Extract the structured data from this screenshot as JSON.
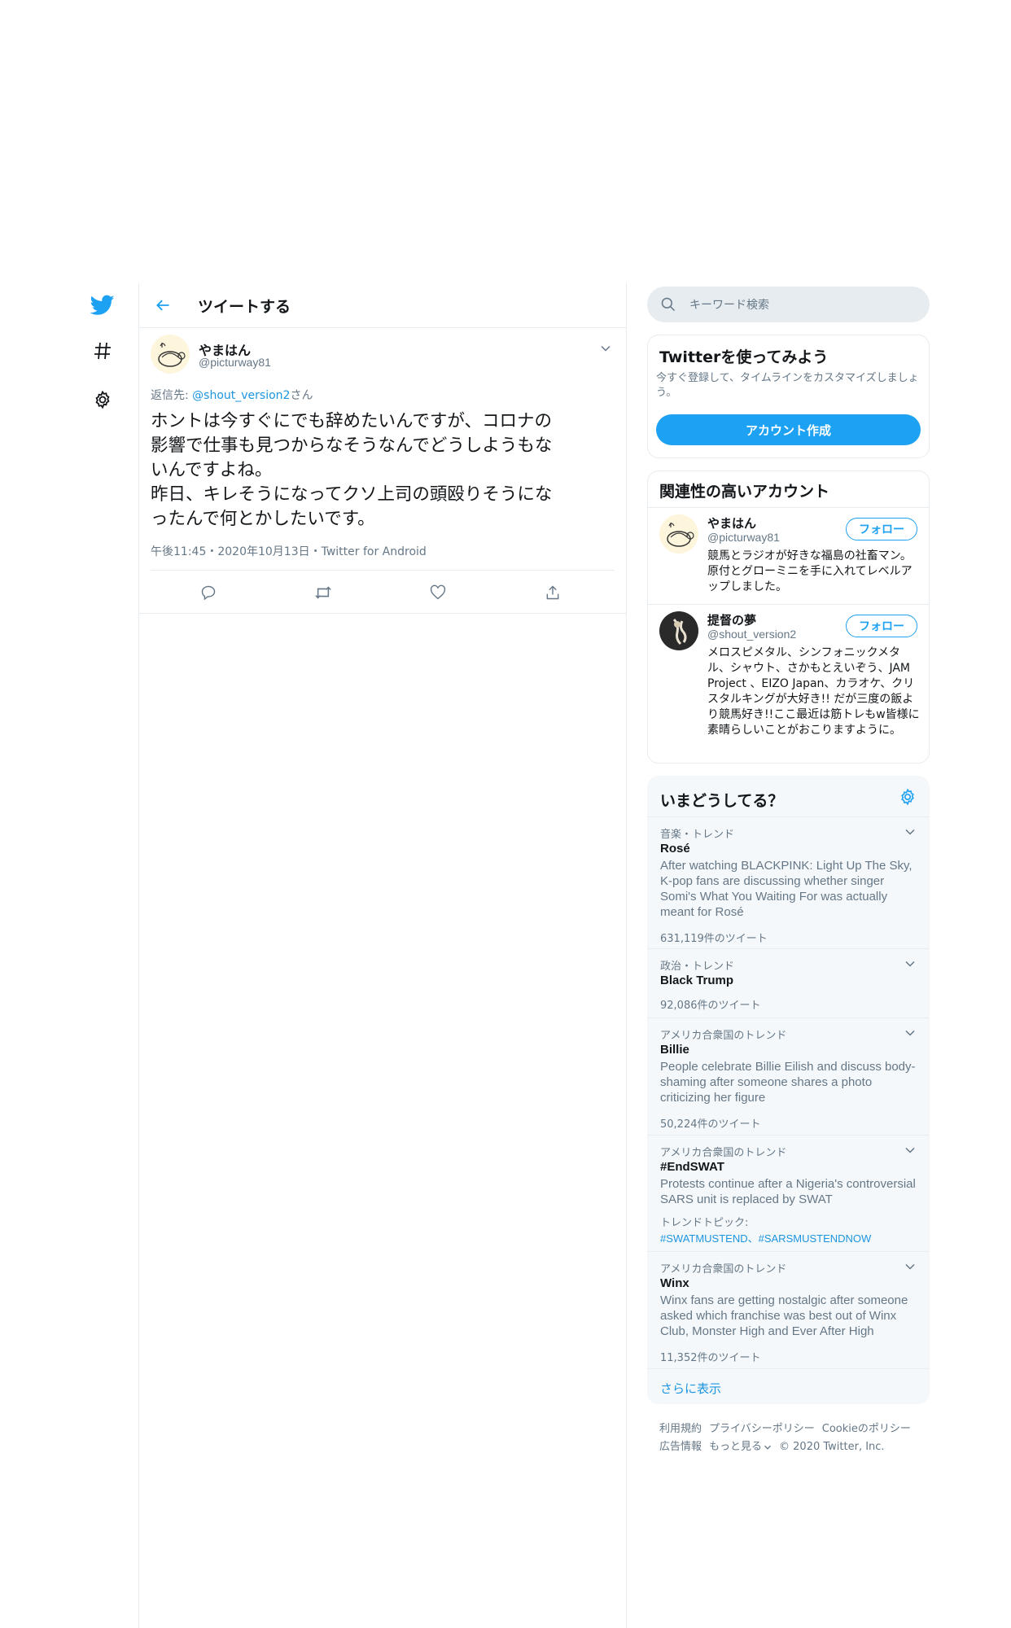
{
  "nav": {
    "icons": [
      "twitter-bird-icon",
      "hashtag-icon",
      "gear-icon"
    ]
  },
  "header": {
    "title": "ツイートする"
  },
  "tweet": {
    "author_name": "やまはん",
    "author_handle": "@picturway81",
    "reply_label": "返信先:",
    "reply_to": "@shout_version2",
    "reply_suffix": "さん",
    "text": "ホントは今すぐにでも辞めたいんですが、コロナの\n影響で仕事も見つからなそうなんでどうしようもな\nいんですよね。\n昨日、キレそうになってクソ上司の頭殴りそうにな\nったんで何とかしたいです。",
    "meta": "午後11:45・2020年10月13日・Twitter for Android"
  },
  "search": {
    "placeholder": "キーワード検索"
  },
  "signup": {
    "title": "Twitterを使ってみよう",
    "desc": "今すぐ登録して、タイムラインをカスタマイズしましょう。",
    "button": "アカウント作成"
  },
  "relevant": {
    "title": "関連性の高いアカウント",
    "accounts": [
      {
        "name": "やまはん",
        "handle": "@picturway81",
        "follow": "フォロー",
        "bio": "競馬とラジオが好きな福島の社畜マン。 原付とグローミニを手に入れてレベルアップしました。"
      },
      {
        "name": "提督の夢",
        "handle": "@shout_version2",
        "follow": "フォロー",
        "bio": "メロスピメタル、シンフォニックメタル、シャウト、さかもとえいぞう、JAM Project 、EIZO Japan、カラオケ、クリスタルキングが大好き!! だが三度の飯より競馬好き!!ここ最近は筋トレもw皆様に素晴らしいことがおこりますように。"
      }
    ]
  },
  "trends": {
    "title": "いまどうしてる？",
    "items": [
      {
        "context": "音楽・トレンド",
        "name": "Rosé",
        "desc": "After watching BLACKPINK: Light Up The Sky, K-pop fans are discussing whether singer Somi's What You Waiting For was actually meant for Rosé",
        "count": "631,119件のツイート"
      },
      {
        "context": "政治・トレンド",
        "name": "Black Trump",
        "count": "92,086件のツイート"
      },
      {
        "context": "アメリカ合衆国のトレンド",
        "name": "Billie",
        "desc": "People celebrate Billie Eilish and discuss body-shaming after someone shares a photo criticizing her figure",
        "count": "50,224件のツイート"
      },
      {
        "context": "アメリカ合衆国のトレンド",
        "name": "#EndSWAT",
        "desc": "Protests continue after a Nigeria's controversial SARS unit is replaced by SWAT",
        "topics_label": "トレンドトピック:",
        "topics": "#SWATMUSTEND、#SARSMUSTENDNOW"
      },
      {
        "context": "アメリカ合衆国のトレンド",
        "name": "Winx",
        "desc": "Winx fans are getting nostalgic after someone asked which franchise was best out of Winx Club, Monster High and Ever After High",
        "count": "11,352件のツイート"
      }
    ],
    "show_more": "さらに表示"
  },
  "footer": {
    "terms": "利用規約",
    "privacy": "プライバシーポリシー",
    "cookies": "Cookieのポリシー",
    "ads": "広告情報",
    "more": "もっと見る",
    "copyright": "© 2020 Twitter, Inc."
  },
  "colors": {
    "accent": "#1da1f2",
    "link": "#1b95e0",
    "muted": "#657786",
    "border": "#e6ecf0"
  }
}
